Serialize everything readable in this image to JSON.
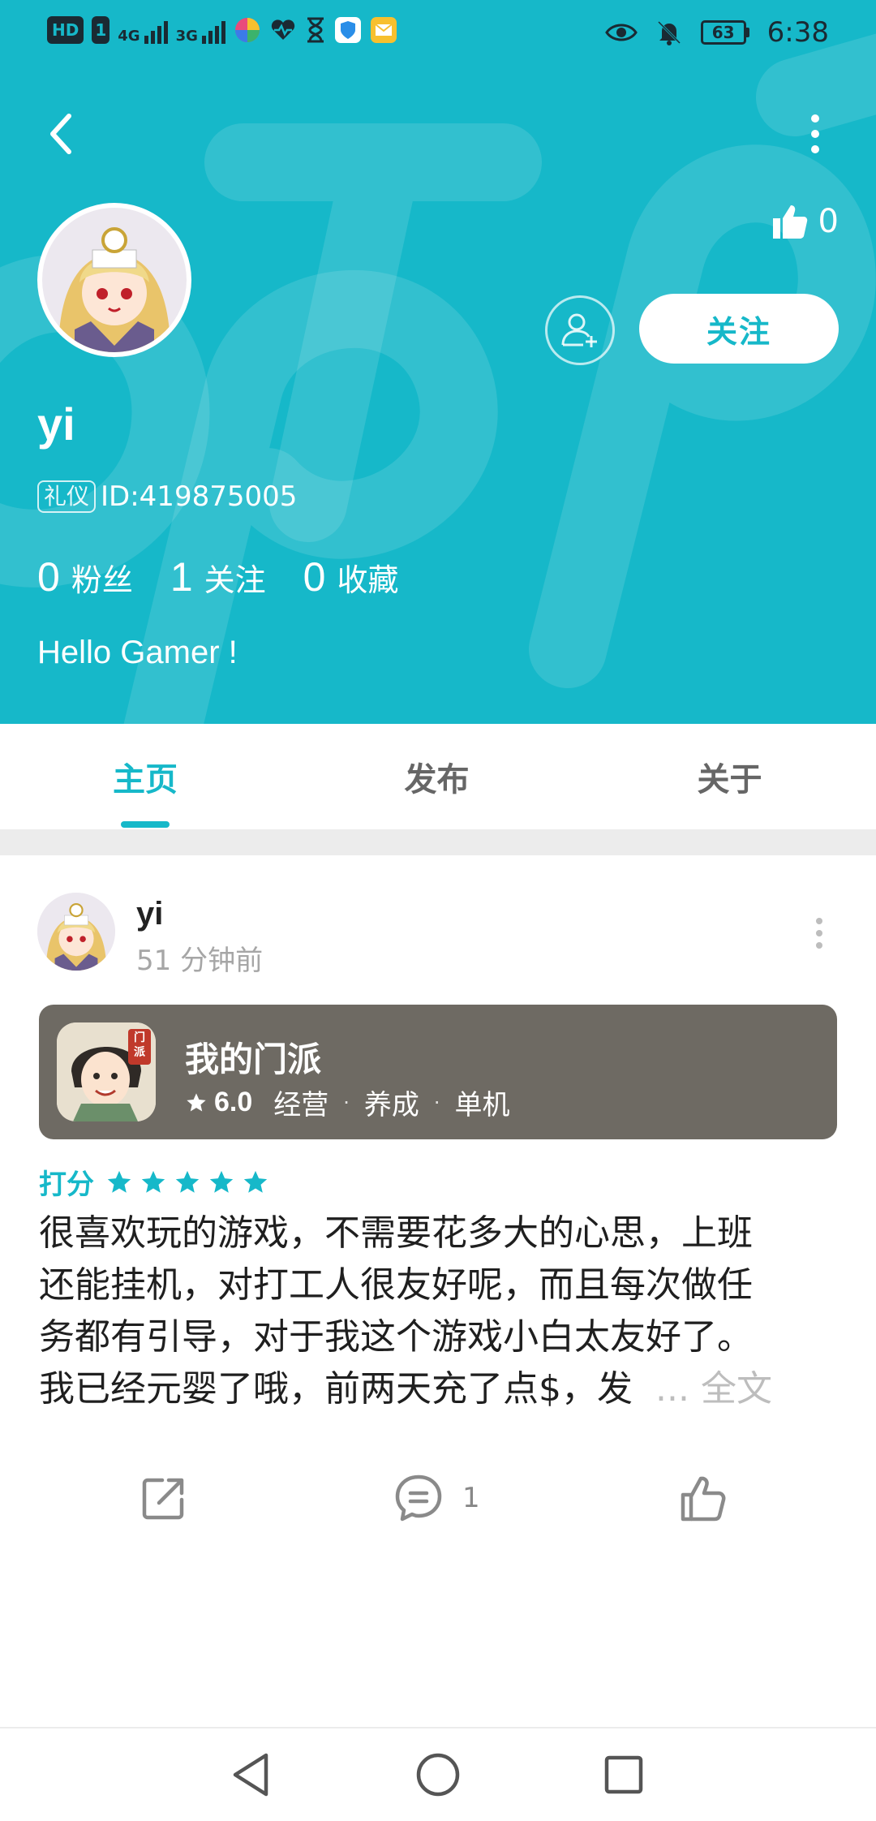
{
  "status_bar": {
    "left_chips": [
      "HD",
      "1",
      "4G",
      "3G"
    ],
    "battery": "63",
    "time": "6:38"
  },
  "header": {
    "likes_count": "0",
    "follow_label": "关注",
    "username": "yi",
    "id_badge": "礼仪",
    "id_text": "ID:419875005",
    "stats": [
      {
        "num": "0",
        "label": "粉丝"
      },
      {
        "num": "1",
        "label": "关注"
      },
      {
        "num": "0",
        "label": "收藏"
      }
    ],
    "bio": "Hello Gamer !",
    "bg_color": "#16b8c9"
  },
  "tabs": [
    {
      "label": "主页",
      "active": true
    },
    {
      "label": "发布",
      "active": false
    },
    {
      "label": "关于",
      "active": false
    }
  ],
  "post": {
    "author": "yi",
    "time": "51 分钟前",
    "game": {
      "title": "我的门派",
      "rating": "6.0",
      "tags": [
        "经营",
        "养成",
        "单机"
      ],
      "icon_badge": "门派"
    },
    "score_label": "打分",
    "stars": 5,
    "review_lines": [
      "很喜欢玩的游戏，不需要花多大的心思，上班",
      "还能挂机，对打工人很友好呢，而且每次做任",
      "务都有引导，对于我这个游戏小白太友好了。",
      "我已经元婴了哦，前两天充了点$，发"
    ],
    "fulltext_label": "... 全文",
    "comment_count": "1"
  },
  "icons": {
    "back": "back-arrow-icon",
    "more": "more-vertical-icon",
    "like": "thumb-up-icon",
    "add_friend": "add-user-icon",
    "share": "share-icon",
    "comment": "comment-icon",
    "nav_back": "triangle-back-icon",
    "nav_home": "circle-home-icon",
    "nav_recent": "square-recent-icon"
  }
}
